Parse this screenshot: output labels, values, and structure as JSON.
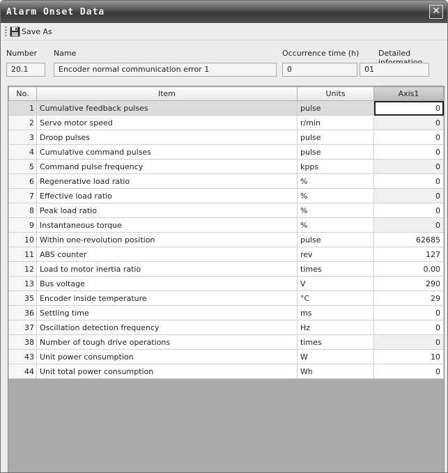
{
  "window": {
    "title": "Alarm Onset Data",
    "close_glyph": "✕"
  },
  "toolbar": {
    "save_label": "Save As",
    "save_icon": "floppy-disk-icon"
  },
  "fields": {
    "number_label": "Number",
    "number_value": "20.1",
    "name_label": "Name",
    "name_value": "Encoder normal communication error 1",
    "occurrence_label": "Occurrence time (h)",
    "occurrence_value": "0",
    "detail_label": "Detailed information",
    "detail_value": "01"
  },
  "grid": {
    "columns": [
      "No.",
      "Item",
      "Units",
      "Axis1"
    ],
    "rows": [
      {
        "no": "1",
        "item": "Cumulative feedback pulses",
        "unit": "pulse",
        "value": "0"
      },
      {
        "no": "2",
        "item": "Servo motor speed",
        "unit": "r/min",
        "value": "0"
      },
      {
        "no": "3",
        "item": "Droop pulses",
        "unit": "pulse",
        "value": "0"
      },
      {
        "no": "4",
        "item": "Cumulative command pulses",
        "unit": "pulse",
        "value": "0"
      },
      {
        "no": "5",
        "item": "Command pulse frequency",
        "unit": "kpps",
        "value": "0"
      },
      {
        "no": "6",
        "item": "Regenerative load ratio",
        "unit": "%",
        "value": "0"
      },
      {
        "no": "7",
        "item": "Effective load ratio",
        "unit": "%",
        "value": "0"
      },
      {
        "no": "8",
        "item": "Peak load ratio",
        "unit": "%",
        "value": "0"
      },
      {
        "no": "9",
        "item": "Instantaneous torque",
        "unit": "%",
        "value": "0"
      },
      {
        "no": "10",
        "item": "Within one-revolution position",
        "unit": "pulse",
        "value": "62685"
      },
      {
        "no": "11",
        "item": "ABS counter",
        "unit": "rev",
        "value": "127"
      },
      {
        "no": "12",
        "item": "Load to motor inertia ratio",
        "unit": "times",
        "value": "0.00"
      },
      {
        "no": "13",
        "item": "Bus voltage",
        "unit": "V",
        "value": "290"
      },
      {
        "no": "35",
        "item": "Encoder inside temperature",
        "unit": "°C",
        "value": "29"
      },
      {
        "no": "36",
        "item": "Settling time",
        "unit": "ms",
        "value": "0"
      },
      {
        "no": "37",
        "item": "Oscillation detection frequency",
        "unit": "Hz",
        "value": "0"
      },
      {
        "no": "38",
        "item": "Number of tough drive operations",
        "unit": "times",
        "value": "0"
      },
      {
        "no": "43",
        "item": "Unit power consumption",
        "unit": "W",
        "value": "10"
      },
      {
        "no": "44",
        "item": "Unit total power consumption",
        "unit": "Wh",
        "value": "0"
      }
    ]
  }
}
